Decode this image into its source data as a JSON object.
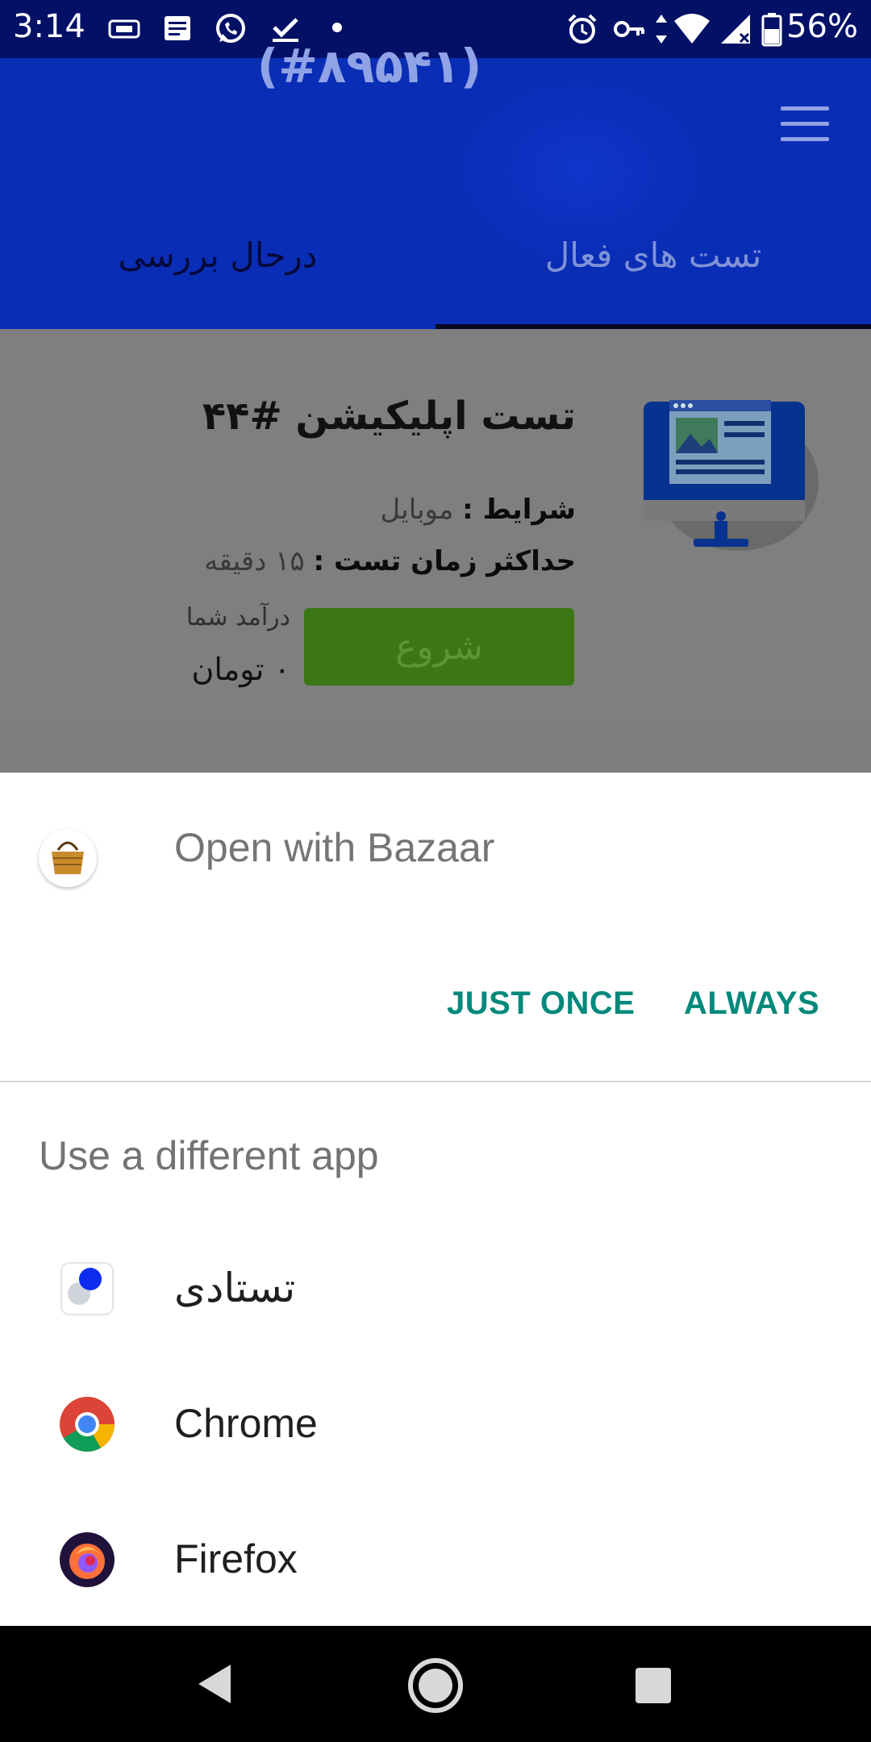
{
  "status_bar": {
    "time": "3:14",
    "battery": "56%"
  },
  "app_bar": {
    "title": "(#۸۹۵۴۱)",
    "tabs": [
      {
        "label": "تست های فعال",
        "selected": true
      },
      {
        "label": "درحال بررسی",
        "selected": false
      }
    ]
  },
  "card": {
    "title": "تست اپلیکیشن #۴۴",
    "conditions_label": "شرایط :",
    "conditions_value": "موبایل",
    "max_time_label": "حداکثر زمان تست :",
    "max_time_value": "۱۵ دقیقه",
    "start_label": "شروع",
    "income_label": "درآمد شما",
    "income_value": "۰ تومان"
  },
  "dialog": {
    "open_with": "Open with Bazaar",
    "just_once": "JUST ONCE",
    "always": "ALWAYS",
    "different_app": "Use a different app",
    "apps": [
      {
        "name": "تستادی",
        "icon": "testadi-icon"
      },
      {
        "name": "Chrome",
        "icon": "chrome-icon"
      },
      {
        "name": "Firefox",
        "icon": "firefox-icon"
      }
    ]
  },
  "colors": {
    "app_bar": "#0a2db5",
    "status_bar": "#021066",
    "accent": "#00897b",
    "start_button": "#3b7714"
  }
}
